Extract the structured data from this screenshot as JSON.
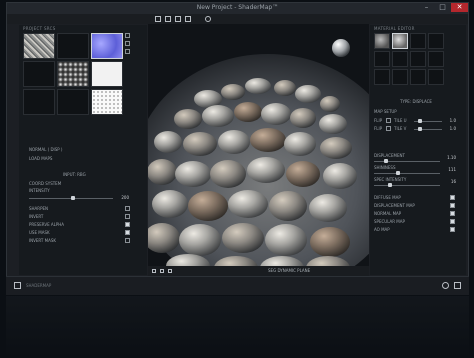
{
  "window": {
    "title": "New Project - ShaderMap™",
    "min": "–",
    "max": "□",
    "close": "✕"
  },
  "left": {
    "section": "PROJECT SRCS",
    "map_type": "NORMAL ( DISP )",
    "load_maps": "LOAD MAPS",
    "input_label": "INPUT: RBG",
    "coord_label": "COORD SYSTEM",
    "intensity_label": "INTENSITY",
    "intensity_value": "200",
    "options": [
      {
        "label": "SHARPEN",
        "checked": false
      },
      {
        "label": "INVERT",
        "checked": false
      },
      {
        "label": "PRESERVE ALPHA",
        "checked": true
      },
      {
        "label": "USE MASK",
        "checked": true
      },
      {
        "label": "INVERT MASK",
        "checked": false
      }
    ]
  },
  "right": {
    "section": "MATERIAL EDITOR",
    "type_label": "TYPE: DISPLACE",
    "map_setup": "MAP SETUP",
    "flip_u": "FLIP",
    "flip_v": "FLIP",
    "tile_u": "TILE U",
    "tile_v": "TILE V",
    "tile_u_value": "1.0",
    "tile_v_value": "1.0",
    "params": [
      {
        "label": "DISPLACEMENT",
        "value": "1.10"
      },
      {
        "label": "SHININESS",
        "value": "111"
      },
      {
        "label": "SPEC INTENSITY",
        "value": "16"
      }
    ],
    "maps": [
      {
        "label": "DIFFUSE MAP",
        "checked": true
      },
      {
        "label": "DISPLACEMENT MAP",
        "checked": true
      },
      {
        "label": "NORMAL MAP",
        "checked": true
      },
      {
        "label": "SPECULAR MAP",
        "checked": true
      },
      {
        "label": "AO MAP",
        "checked": true
      }
    ]
  },
  "viewport": {
    "status": "SEG DYNAMIC PLANE"
  },
  "taskbar": {
    "app_name": "SHADERMAP"
  }
}
